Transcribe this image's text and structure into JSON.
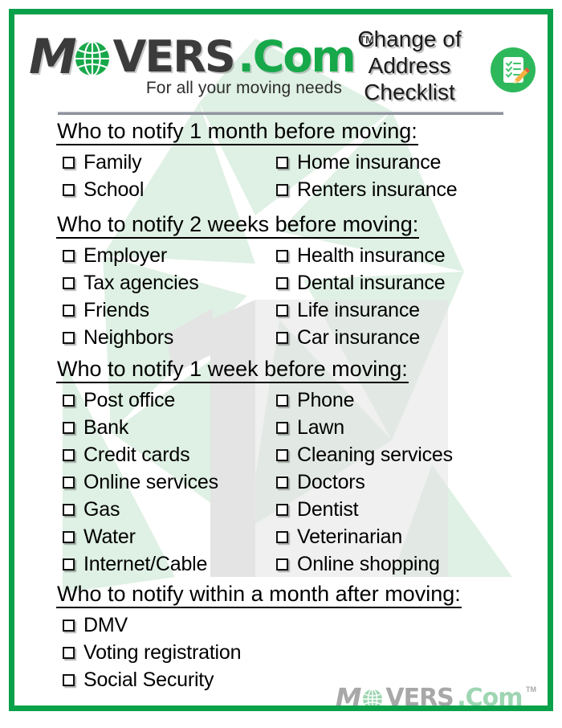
{
  "header": {
    "logo": {
      "part1": "M",
      "globe_icon": "globe-icon",
      "part2": "VERS",
      "part3": ".Com",
      "trademark": "TM",
      "tagline": "For all your moving needs"
    },
    "title_line1": "Change of",
    "title_line2": "Address",
    "title_line3": "Checklist",
    "icon": "checklist-clipboard-pencil-icon"
  },
  "colors": {
    "brand_green": "#0aa14b",
    "logo_green": "#17a84a",
    "icon_green": "#2eb85c",
    "rule_gray": "#8f949e",
    "text_black": "#000000"
  },
  "sections": [
    {
      "title": "Who to notify 1 month before moving:",
      "layout": "two-column",
      "left": [
        "Family",
        "School"
      ],
      "right": [
        "Home insurance",
        "Renters insurance"
      ]
    },
    {
      "title": "Who to notify 2 weeks before moving:",
      "layout": "two-column",
      "left": [
        "Employer",
        "Tax agencies",
        "Friends",
        "Neighbors"
      ],
      "right": [
        "Health insurance",
        "Dental insurance",
        "Life insurance",
        "Car insurance"
      ]
    },
    {
      "title": "Who to notify 1 week before moving:",
      "layout": "two-column",
      "left": [
        "Post office",
        "Bank",
        "Credit cards",
        "Online services",
        "Gas",
        "Water",
        "Internet/Cable"
      ],
      "right": [
        "Phone",
        "Lawn",
        "Cleaning services",
        "Doctors",
        "Dentist",
        "Veterinarian",
        "Online shopping"
      ]
    },
    {
      "title": "Who to notify within a month after moving:",
      "layout": "single-column",
      "left": [
        "DMV",
        "Voting registration",
        "Social Security"
      ],
      "right": []
    }
  ],
  "footer": {
    "logo": {
      "part1": "M",
      "globe_icon": "globe-icon",
      "part2": "VERS",
      "part3": ".Com",
      "trademark": "TM"
    }
  }
}
